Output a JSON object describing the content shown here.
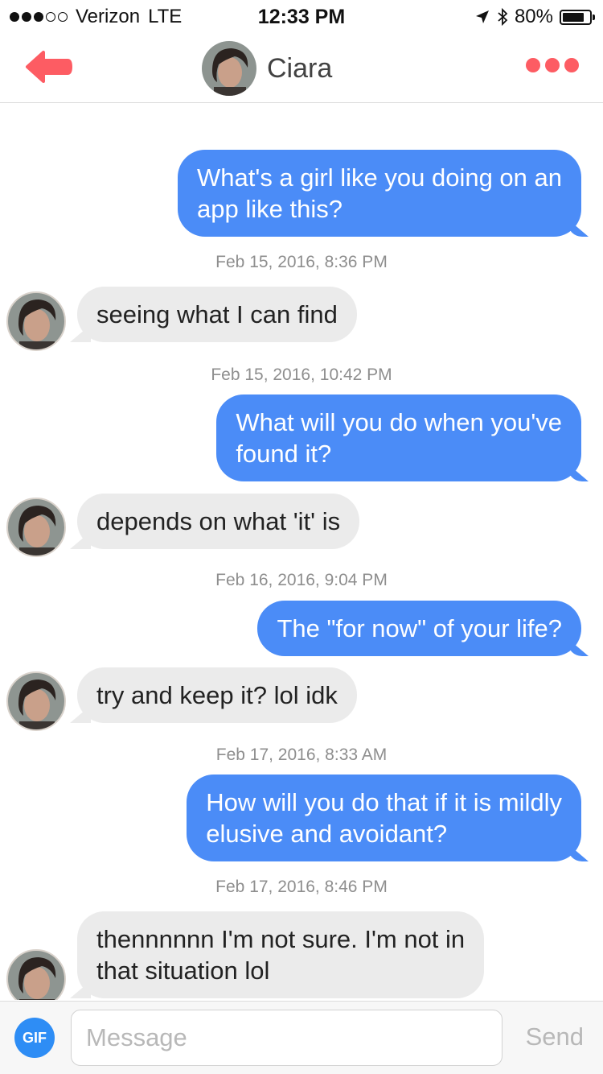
{
  "status_bar": {
    "carrier": "Verizon",
    "network": "LTE",
    "time": "12:33 PM",
    "battery_text": "80%",
    "battery_level": 0.8,
    "signal_bars_filled": 3,
    "signal_bars_total": 5,
    "icons": [
      "location-arrow-icon",
      "bluetooth-icon",
      "battery-icon"
    ]
  },
  "header": {
    "title": "Ciara",
    "back_icon": "back-arrow-icon",
    "more_icon": "more-dots-icon",
    "accent_color": "#fd5c63"
  },
  "thread": {
    "colors": {
      "outgoing": "#4b8cf7",
      "incoming": "#ebebeb"
    },
    "messages": [
      {
        "direction": "out",
        "text_lines": [
          "What's a girl like you doing on an",
          "app like this?"
        ]
      },
      {
        "type": "timestamp",
        "text": "Feb 15, 2016, 8:36 PM"
      },
      {
        "direction": "in",
        "text_lines": [
          "seeing what I can find"
        ]
      },
      {
        "type": "timestamp",
        "text": "Feb 15, 2016, 10:42 PM"
      },
      {
        "direction": "out",
        "text_lines": [
          "What will you do when you've",
          "found it?"
        ]
      },
      {
        "direction": "in",
        "text_lines": [
          "depends on what 'it' is"
        ]
      },
      {
        "type": "timestamp",
        "text": "Feb 16, 2016, 9:04 PM"
      },
      {
        "direction": "out",
        "text_lines": [
          "The \"for now\" of your life?"
        ]
      },
      {
        "direction": "in",
        "text_lines": [
          "try and keep it? lol idk"
        ]
      },
      {
        "type": "timestamp",
        "text": "Feb 17, 2016, 8:33 AM"
      },
      {
        "direction": "out",
        "text_lines": [
          "How will you do that if it is mildly",
          "elusive and avoidant?"
        ]
      },
      {
        "type": "timestamp",
        "text": "Feb 17, 2016, 8:46 PM"
      },
      {
        "direction": "in",
        "text_lines": [
          "thennnnnn I'm not sure. I'm not in",
          "that situation lol"
        ]
      }
    ]
  },
  "composer": {
    "gif_label": "GIF",
    "placeholder": "Message",
    "value": "",
    "send_label": "Send"
  }
}
